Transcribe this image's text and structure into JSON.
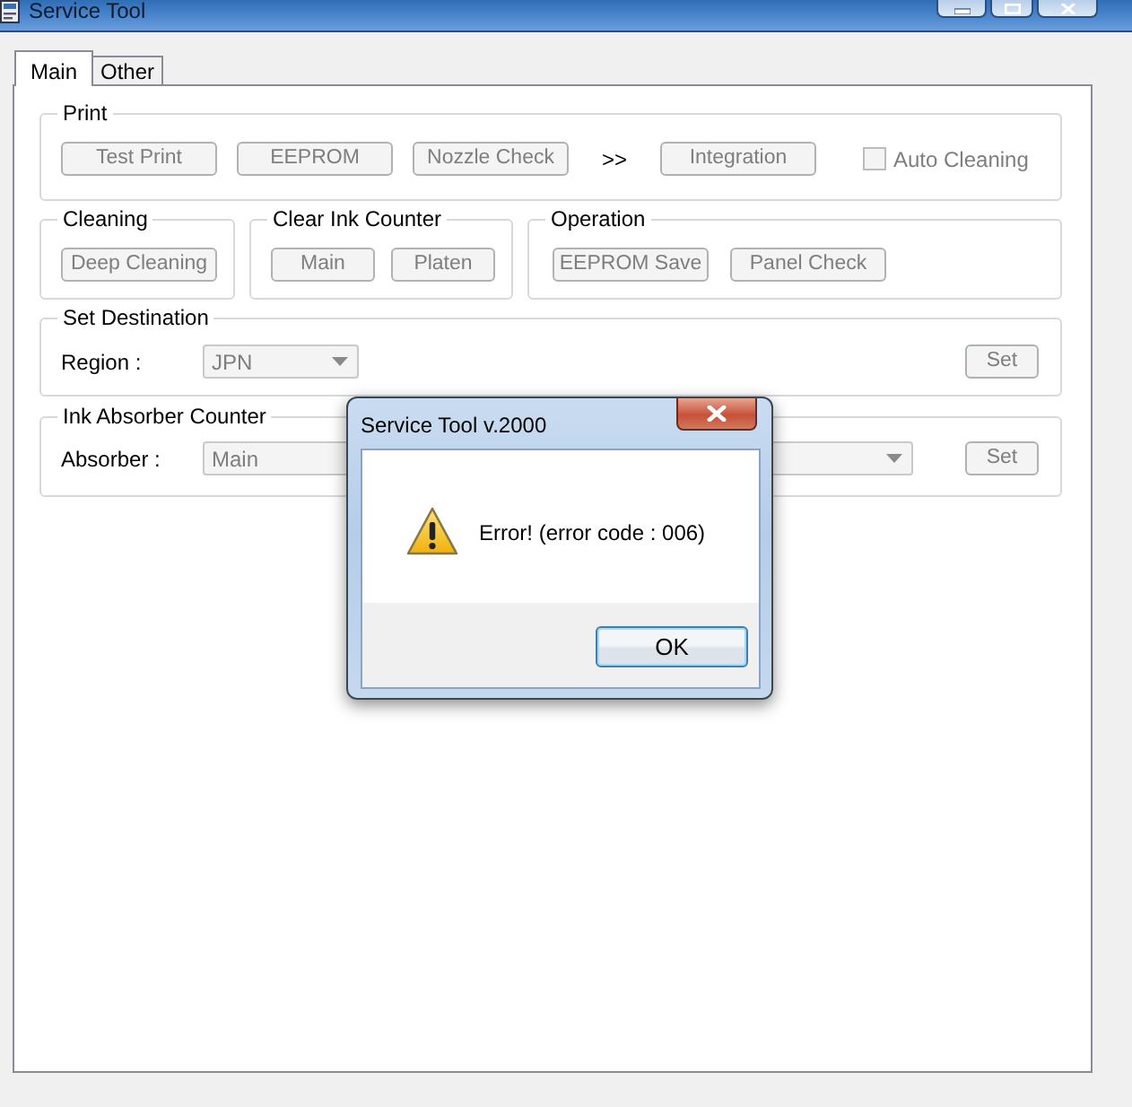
{
  "window": {
    "title": "Service Tool"
  },
  "tabs": [
    {
      "label": "Main",
      "selected": true
    },
    {
      "label": "Other",
      "selected": false
    }
  ],
  "print_group": {
    "title": "Print",
    "buttons": [
      {
        "label": "Test Print",
        "disabled": true
      },
      {
        "label": "EEPROM",
        "disabled": true
      },
      {
        "label": "Nozzle Check",
        "disabled": true
      }
    ],
    "arrow": ">>",
    "integration_button": {
      "label": "Integration",
      "disabled": true
    },
    "auto_cleaning": {
      "label": "Auto Cleaning",
      "checked": false,
      "disabled": true
    }
  },
  "groups_row": [
    {
      "title": "Cleaning",
      "buttons": [
        {
          "label": "Deep Cleaning",
          "disabled": true
        }
      ]
    },
    {
      "title": "Clear Ink Counter",
      "buttons": [
        {
          "label": "Main",
          "disabled": true
        },
        {
          "label": "Platen",
          "disabled": true
        }
      ]
    },
    {
      "title": "Operation",
      "buttons": [
        {
          "label": "EEPROM Save",
          "disabled": true
        },
        {
          "label": "Panel Check",
          "disabled": true
        }
      ]
    }
  ],
  "set_destination": {
    "title": "Set Destination",
    "label": "Region :",
    "dropdown": {
      "value": "JPN",
      "disabled": true
    },
    "set_button": {
      "label": "Set",
      "disabled": true
    }
  },
  "ink_absorber_counter": {
    "title": "Ink Absorber Counter",
    "label": "Absorber :",
    "dropdowns": [
      {
        "value": "Main",
        "disabled": true
      },
      {
        "disabled": true
      }
    ],
    "set_button": {
      "label": "Set",
      "disabled": true
    }
  },
  "dialog": {
    "kind": "warning",
    "title": "Service Tool v.2000",
    "message": "Error! (error code : 006)",
    "buttons": [
      {
        "label": "OK",
        "default": true
      }
    ]
  }
}
